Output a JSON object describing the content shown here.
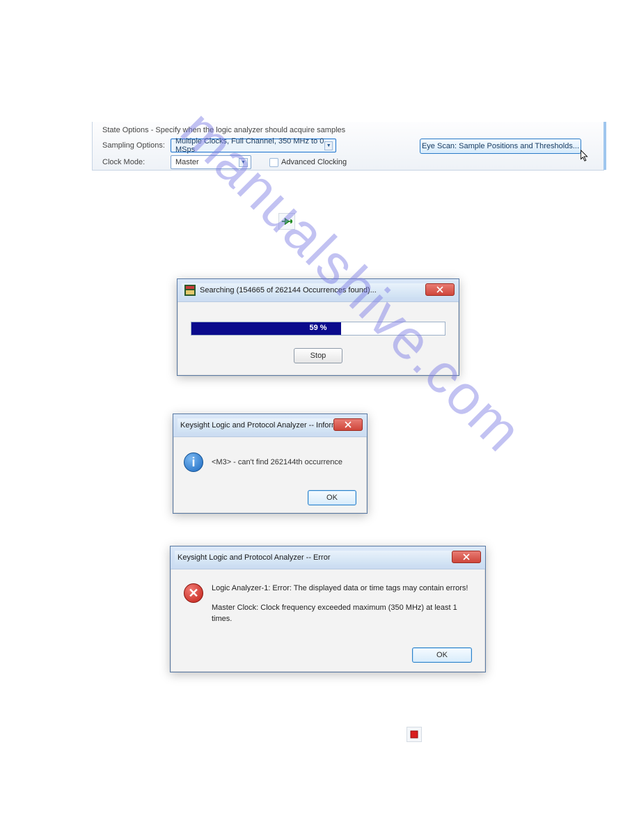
{
  "watermark": "manualshive.com",
  "stateOptions": {
    "heading": "State Options - Specify when the logic analyzer should acquire samples",
    "samplingLabel": "Sampling Options:",
    "samplingValue": "Multiple Clocks, Full Channel, 350 MHz to 0 MSps",
    "clockModeLabel": "Clock Mode:",
    "clockModeValue": "Master",
    "advancedClockingLabel": "Advanced Clocking",
    "advancedClockingChecked": false,
    "eyeScanButton": "Eye Scan: Sample Positions and Thresholds..."
  },
  "searchDialog": {
    "title": "Searching (154665 of 262144 Occurrences found)...",
    "progressPercent": 59,
    "progressLabel": "59 %",
    "stopButton": "Stop"
  },
  "infoDialog": {
    "title": "Keysight Logic and Protocol Analyzer -- Information",
    "message": "<M3> - can't find 262144th occurrence",
    "okButton": "OK"
  },
  "errorDialog": {
    "title": "Keysight Logic and Protocol Analyzer -- Error",
    "line1": "Logic Analyzer-1: Error: The displayed data or time tags may contain errors!",
    "line2": "Master Clock: Clock frequency exceeded maximum (350 MHz) at least 1 times.",
    "okButton": "OK"
  }
}
